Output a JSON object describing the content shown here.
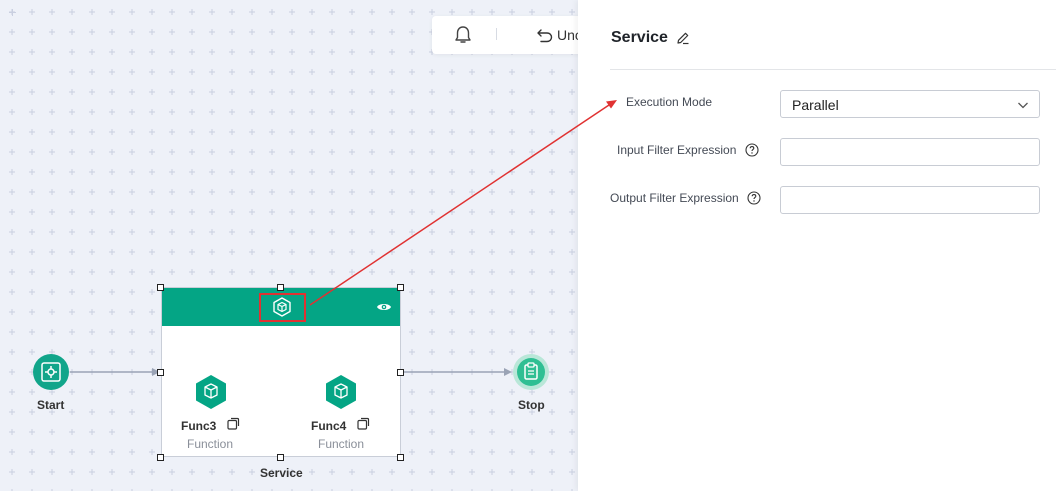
{
  "toolbar": {
    "undo_label": "Unc",
    "bell_icon": "bell-icon",
    "undo_icon": "undo-icon"
  },
  "flow": {
    "start_label": "Start",
    "stop_label": "Stop",
    "service_label": "Service",
    "functions": [
      {
        "name": "Func3",
        "type": "Function"
      },
      {
        "name": "Func4",
        "type": "Function"
      }
    ]
  },
  "panel": {
    "title": "Service",
    "fields": [
      {
        "label": "Execution Mode",
        "value": "Parallel",
        "kind": "select"
      },
      {
        "label": "Input Filter Expression",
        "value": "",
        "kind": "text"
      },
      {
        "label": "Output Filter Expression",
        "value": "",
        "kind": "text"
      }
    ]
  },
  "colors": {
    "accent": "#04a585",
    "annotation": "#e03232",
    "canvas": "#eef1f8"
  }
}
